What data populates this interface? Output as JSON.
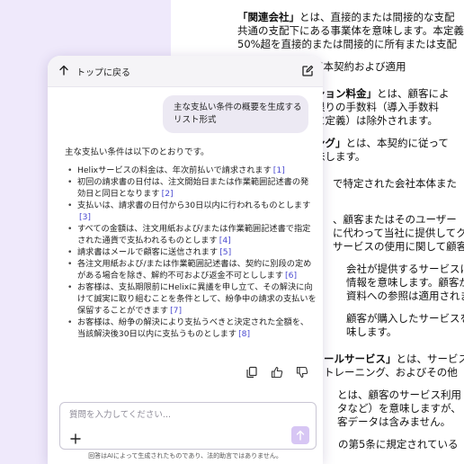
{
  "document": {
    "lines": [
      {
        "bold": "「関連会社」",
        "text": "とは、直接的または間接的な支配"
      },
      {
        "bold": "",
        "text": "共通の支配下にある事業体を意味します。本定義"
      },
      {
        "bold": "",
        "text": "50%超を直接的または間接的に所有または支配"
      },
      {
        "bold": "",
        "text": "サービス基本契約および適用"
      },
      {
        "bold": "ション料金」",
        "text": "とは、顧客によ"
      },
      {
        "bold": "",
        "text": "限りの手数料（導入手数料"
      },
      {
        "bold": "",
        "text": "に定義）は除外されます。"
      },
      {
        "bold": "ング」",
        "text": "とは、本契約に従って"
      },
      {
        "bold": "",
        "text": "味します。"
      },
      {
        "bold": "",
        "text": "で特定された会社本体また"
      },
      {
        "bold": "",
        "text": "、顧客またはそのユーザー"
      },
      {
        "bold": "",
        "text": "に代わって当社に提供してク"
      },
      {
        "bold": "",
        "text": "サービスの使用に関して顧客"
      },
      {
        "bold": "",
        "text": "会社が提供するサービスに関"
      },
      {
        "bold": "",
        "text": "情報を意味します。顧客が"
      },
      {
        "bold": "",
        "text": "資料への参照は適用されま"
      },
      {
        "bold": "",
        "text": "顧客が購入したサービスを"
      },
      {
        "bold": "",
        "text": "味します。"
      },
      {
        "bold": "ールサービス」",
        "text": "とは、サービス"
      },
      {
        "bold": "",
        "text": "トレーニング、およびその他"
      },
      {
        "bold": "",
        "text": "とは、顧客のサービス利用"
      },
      {
        "bold": "",
        "text": "タなど）を意味しますが、"
      },
      {
        "bold": "",
        "text": "客データは含みません。"
      },
      {
        "bold": "",
        "text": "の第5条に規定されている"
      }
    ]
  },
  "header": {
    "back_label": "トップに戻る"
  },
  "conversation": {
    "user_message": "主な支払い条件の概要を生成するリスト形式",
    "intro": "主な支払い条件は以下のとおりです。",
    "items": [
      {
        "text": "Helixサービスの料金は、年次前払いで請求されます",
        "ref": "[1]"
      },
      {
        "text": "初回の請求書の日付は、注文開始日または作業範囲記述書の発効日と同日となります",
        "ref": "[2]"
      },
      {
        "text": "支払いは、請求書の日付から30日以内に行われるものとします",
        "ref": "[3]"
      },
      {
        "text": "すべての金額は、注文用紙および/または作業範囲記述書で指定された通貨で支払われるものとします",
        "ref": "[4]"
      },
      {
        "text": "請求書はメールで顧客に送信されます",
        "ref": "[5]"
      },
      {
        "text": "各注文用紙および/または作業範囲記述書は、契約に別段の定めがある場合を除き、解約不可および返金不可としします",
        "ref": "[6]"
      },
      {
        "text": "お客様は、支払期限前にHelixに異議を申し立て、その解決に向けて誠実に取り組むことを条件として、紛争中の請求の支払いを保留することができます",
        "ref": "[7]"
      },
      {
        "text": "お客様は、紛争の解決により支払うべきと決定された全額を、当該解決後30日以内に支払うものとします",
        "ref": "[8]"
      }
    ]
  },
  "composer": {
    "placeholder": "質問を入力してください..."
  },
  "footer": {
    "disclaimer": "回答はAIによって生成されたものであり、法的助言ではありません。"
  },
  "icons": {
    "back": "arrow-up-icon",
    "compose": "edit-icon",
    "copy": "copy-icon",
    "like": "thumbs-up-icon",
    "dislike": "thumbs-down-icon",
    "add": "plus-icon",
    "send": "arrow-up-icon"
  },
  "colors": {
    "accent": "#d7c6f4",
    "background": "#efe9fb",
    "reference": "#4a4ad0"
  }
}
